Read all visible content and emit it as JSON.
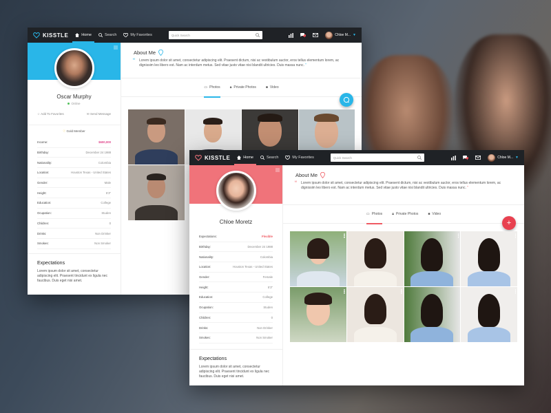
{
  "colors": {
    "accent1": "#29b6e8",
    "accent2": "#f0737a",
    "brand_pink": "#e0468c",
    "nav_bg": "#1f2226"
  },
  "window1": {
    "nav": {
      "logo": "KISSTLE",
      "items": [
        {
          "label": "Home",
          "icon": "home-icon"
        },
        {
          "label": "Search",
          "icon": "search-icon"
        },
        {
          "label": "My Favorites",
          "icon": "heart-icon"
        }
      ],
      "search_placeholder": "Quick Search",
      "user": "Chloe M..."
    },
    "profile": {
      "name": "Oscar Murphy",
      "status": "Online",
      "add_favorite": "Add To Favorites",
      "send_message": "Send Message",
      "membership": "Gold Member",
      "attributes": [
        {
          "label": "Income:",
          "value": "$600,000"
        },
        {
          "label": "Birthday:",
          "value": "December 24 1988"
        },
        {
          "label": "Nationality:",
          "value": "Colombia"
        },
        {
          "label": "Location:",
          "value": "Houston Texas - United States"
        },
        {
          "label": "Gender:",
          "value": "Male"
        },
        {
          "label": "Height:",
          "value": "5'3\""
        },
        {
          "label": "Education:",
          "value": "College"
        },
        {
          "label": "Ocupation:",
          "value": "Studen"
        },
        {
          "label": "Children:",
          "value": "0"
        },
        {
          "label": "Drinks:",
          "value": "Non Drinker"
        },
        {
          "label": "Smokes:",
          "value": "Non Smoker"
        }
      ],
      "expectations_title": "Expectations",
      "expectations_text": "Lorem ipsum dolor sit amet, consectetur adipiscing elit. Praesent tincidunt ex ligula nec faucibus. Duis eget nisi amet."
    },
    "about": {
      "title": "About Me",
      "text": "Lorem ipsum dolor sit amet, consectetur adipiscing elit. Praesent dictum, nisi ac vestibulum auctor, eros tellus elementum lorem, ac dignissim leo libero est. Nam ac interdum metus. Sed vitae justo vitae nisi blandit ultricies. Duis massa nunc."
    },
    "tabs": [
      {
        "label": "Photos",
        "icon": "photos-icon"
      },
      {
        "label": "Private Photos",
        "icon": "lock-icon"
      },
      {
        "label": "Video",
        "icon": "video-icon"
      }
    ]
  },
  "window2": {
    "nav": {
      "logo": "KISSTLE",
      "items": [
        {
          "label": "Home",
          "icon": "home-icon"
        },
        {
          "label": "Search",
          "icon": "search-icon"
        },
        {
          "label": "My Favorites",
          "icon": "heart-icon"
        }
      ],
      "search_placeholder": "Quick Search",
      "user": "Chloe M..."
    },
    "profile": {
      "name": "Chloe Moretz",
      "attributes": [
        {
          "label": "Expectations:",
          "value": "Flexible"
        },
        {
          "label": "Birthday:",
          "value": "December 24 1988"
        },
        {
          "label": "Nationality:",
          "value": "Colombia"
        },
        {
          "label": "Location:",
          "value": "Houston Texas - United States"
        },
        {
          "label": "Gender:",
          "value": "Female"
        },
        {
          "label": "Height:",
          "value": "5'3\""
        },
        {
          "label": "Education:",
          "value": "College"
        },
        {
          "label": "Ocupation:",
          "value": "Studen"
        },
        {
          "label": "Children:",
          "value": "0"
        },
        {
          "label": "Drinks:",
          "value": "Non Drinker"
        },
        {
          "label": "Smokes:",
          "value": "Non Smoker"
        }
      ],
      "expectations_title": "Expectations",
      "expectations_text": "Lorem ipsum dolor sit amet, consectetur adipiscing elit. Praesent tincidunt ex ligula nec faucibus. Duis eget nisi amet."
    },
    "about": {
      "title": "About Me",
      "text": "Lorem ipsum dolor sit amet, consectetur adipiscing elit. Praesent dictum, nisi ac vestibulum auctor, eros tellus elementum lorem, ac dignissim leo libero est. Nam ac interdum metus. Sed vitae justo vitae nisi blandit ultricies. Duis massa nunc."
    },
    "tabs": [
      {
        "label": "Photos",
        "icon": "photos-icon"
      },
      {
        "label": "Private Photos",
        "icon": "lock-icon"
      },
      {
        "label": "Video",
        "icon": "video-icon"
      }
    ]
  }
}
